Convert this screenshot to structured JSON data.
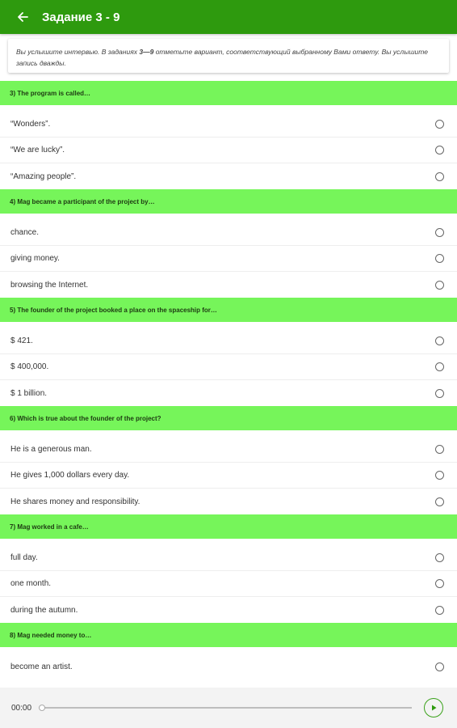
{
  "appbar": {
    "title": "Задание 3 - 9",
    "color": "#2e9a0e"
  },
  "instruction": {
    "part1": "Вы услышите интервью. В заданиях ",
    "range": "3—9",
    "part2": " отметьте вариант, соответствующий выбранному Вами ответу. Вы услышите запись дважды."
  },
  "questions": [
    {
      "header": "3)  The program is called…",
      "options": [
        "“Wonders”.",
        "“We are lucky”.",
        "“Amazing people”."
      ]
    },
    {
      "header": "4)  Mag became a participant of the project by…",
      "options": [
        "chance.",
        "giving money.",
        "browsing the Internet."
      ]
    },
    {
      "header": "5)  The founder of the project booked a place on the spaceship for…",
      "options": [
        "$ 421.",
        "$ 400,000.",
        "$ 1 billion."
      ]
    },
    {
      "header": "6)  Which is true about the founder of the project?",
      "options": [
        "He is a generous man.",
        "He gives 1,000 dollars every day.",
        "He shares money and responsibility."
      ]
    },
    {
      "header": "7)  Mag worked in a cafe…",
      "options": [
        "full day.",
        "one month.",
        "during the autumn."
      ]
    },
    {
      "header": "8)  Mag needed money to…",
      "options": [
        "become an artist."
      ]
    }
  ],
  "player": {
    "time": "00:00",
    "progress": 0
  },
  "colors": {
    "header_bg": "#76f55a",
    "accent": "#3aa21a"
  }
}
